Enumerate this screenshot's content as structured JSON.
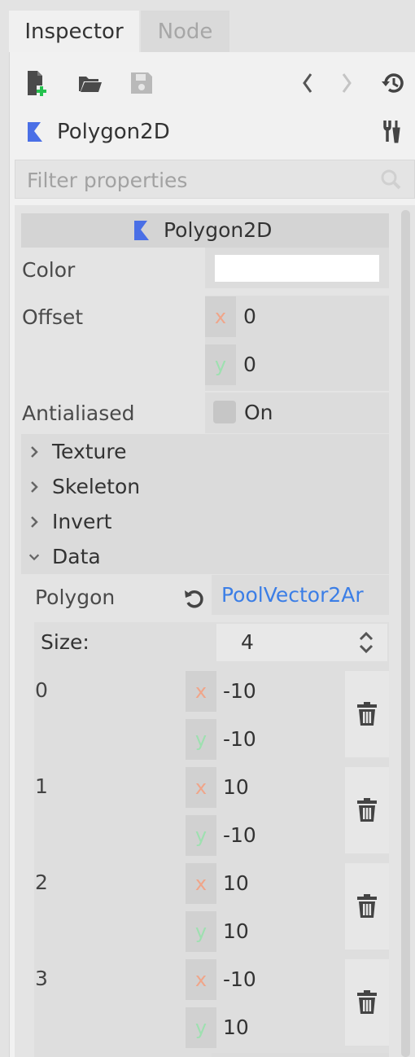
{
  "tabs": {
    "inspector": "Inspector",
    "node": "Node"
  },
  "toolbar": {
    "icons": [
      "new-script-icon",
      "open-folder-icon",
      "save-icon",
      "back-icon",
      "forward-icon",
      "history-icon"
    ],
    "accent_green": "#45ff8b"
  },
  "node": {
    "name": "Polygon2D",
    "icon_color": "#4a6fe6",
    "tools_icon": "tools-icon"
  },
  "filter": {
    "placeholder": "Filter properties"
  },
  "section": {
    "title": "Polygon2D"
  },
  "props": {
    "color_label": "Color",
    "color_value": "#ffffff",
    "offset_label": "Offset",
    "offset_x": "0",
    "offset_y": "0",
    "antialiased_label": "Antialiased",
    "antialiased_value": "On"
  },
  "axis": {
    "x": "x",
    "y": "y"
  },
  "subsections": {
    "texture": "Texture",
    "skeleton": "Skeleton",
    "invert": "Invert",
    "data": "Data"
  },
  "data": {
    "polygon_label": "Polygon",
    "polygon_value": "PoolVector2Ar",
    "size_label": "Size:",
    "size_value": "4",
    "items": [
      {
        "index": "0",
        "x": "-10",
        "y": "-10"
      },
      {
        "index": "1",
        "x": "10",
        "y": "-10"
      },
      {
        "index": "2",
        "x": "10",
        "y": "10"
      },
      {
        "index": "3",
        "x": "-10",
        "y": "10"
      }
    ]
  },
  "colors": {
    "link_blue": "#3b7ee6",
    "axis_x": "#f0a589",
    "axis_y": "#9ee0b0"
  }
}
